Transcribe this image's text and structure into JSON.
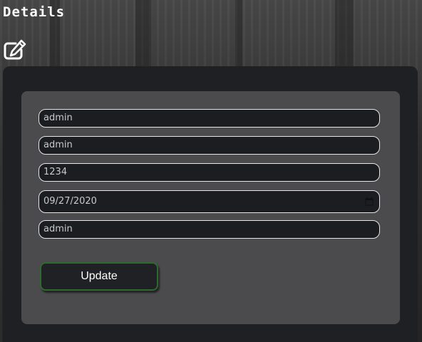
{
  "header": {
    "title": "Details",
    "edit_icon": "edit-icon"
  },
  "form": {
    "fields": [
      {
        "value": "admin",
        "type": "text"
      },
      {
        "value": "admin",
        "type": "text"
      },
      {
        "value": "1234",
        "type": "text"
      },
      {
        "value": "09/27/2020",
        "type": "date",
        "icon": "calendar-icon"
      },
      {
        "value": "admin",
        "type": "text"
      }
    ],
    "submit_label": "Update"
  },
  "colors": {
    "panel": "#1f2023",
    "card": "#4b4b4d",
    "field_bg": "#1c1d21",
    "field_border": "#e6e6e6",
    "button_border": "#2d6a2f"
  }
}
